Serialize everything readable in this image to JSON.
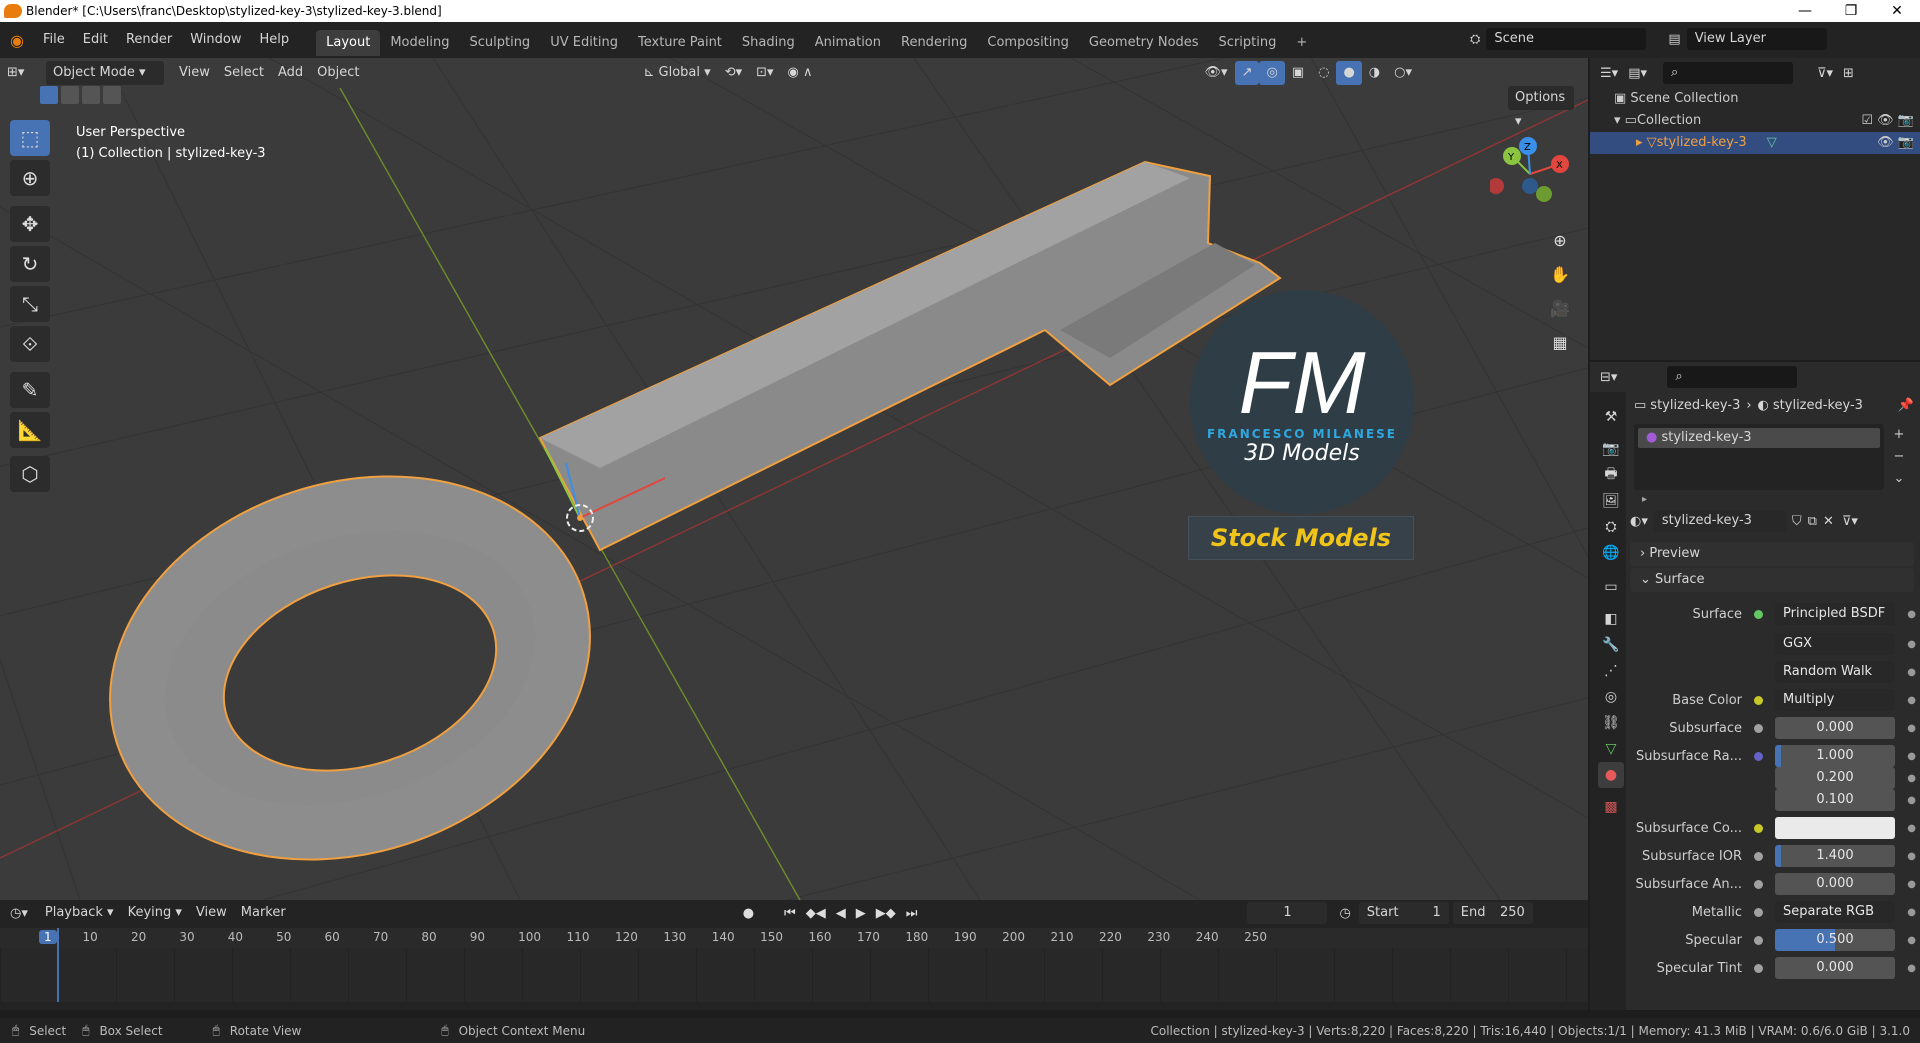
{
  "window": {
    "title": "Blender* [C:\\Users\\franc\\Desktop\\stylized-key-3\\stylized-key-3.blend]",
    "controls": [
      "—",
      "❐",
      "✕"
    ]
  },
  "menus": [
    "File",
    "Edit",
    "Render",
    "Window",
    "Help"
  ],
  "workspaces": [
    "Layout",
    "Modeling",
    "Sculpting",
    "UV Editing",
    "Texture Paint",
    "Shading",
    "Animation",
    "Rendering",
    "Compositing",
    "Geometry Nodes",
    "Scripting",
    "+"
  ],
  "scene": {
    "name": "Scene",
    "view_layer": "View Layer"
  },
  "viewport": {
    "mode": "Object Mode",
    "menus": [
      "View",
      "Select",
      "Add",
      "Object"
    ],
    "orientation": "Global",
    "options": "Options",
    "overlay_line1": "User Perspective",
    "overlay_line2": "(1) Collection | stylized-key-3",
    "gizmo": {
      "x": "X",
      "y": "Y",
      "z": "Z"
    }
  },
  "watermark": {
    "logo_text": "FM",
    "brand": "FRANCESCO MILANESE",
    "sub": "3D Models",
    "banner": "Stock Models"
  },
  "outliner": {
    "root": "Scene Collection",
    "collection": "Collection",
    "object": "stylized-key-3"
  },
  "properties": {
    "breadcrumb_obj": "stylized-key-3",
    "breadcrumb_mat": "stylized-key-3",
    "material_slot": "stylized-key-3",
    "material_name": "stylized-key-3",
    "preview": "Preview",
    "surface_section": "Surface",
    "rows": [
      {
        "label": "Surface",
        "value": "Principled BSDF",
        "kind": "dd",
        "socket": "#63c763"
      },
      {
        "label": "",
        "value": "GGX",
        "kind": "select"
      },
      {
        "label": "",
        "value": "Random Walk",
        "kind": "select"
      },
      {
        "label": "Base Color",
        "value": "Multiply",
        "kind": "dd",
        "socket": "#c7c729",
        "expand": true
      },
      {
        "label": "Subsurface",
        "value": "0.000",
        "kind": "num",
        "socket": "#a1a1a1"
      },
      {
        "label": "Subsurface Ra...",
        "value": "1.000",
        "kind": "num",
        "socket": "#6363c7",
        "fill": 0.05
      },
      {
        "label": "",
        "value": "0.200",
        "kind": "num"
      },
      {
        "label": "",
        "value": "0.100",
        "kind": "num"
      },
      {
        "label": "Subsurface Co...",
        "value": "",
        "kind": "color",
        "socket": "#c7c729"
      },
      {
        "label": "Subsurface IOR",
        "value": "1.400",
        "kind": "num",
        "socket": "#a1a1a1",
        "fill": 0.05
      },
      {
        "label": "Subsurface An...",
        "value": "0.000",
        "kind": "num",
        "socket": "#a1a1a1"
      },
      {
        "label": "Metallic",
        "value": "Separate RGB",
        "kind": "dd",
        "socket": "#a1a1a1",
        "expand": true
      },
      {
        "label": "Specular",
        "value": "0.500",
        "kind": "num",
        "socket": "#a1a1a1",
        "fill": 0.5
      },
      {
        "label": "Specular Tint",
        "value": "0.000",
        "kind": "num",
        "socket": "#a1a1a1"
      }
    ]
  },
  "timeline": {
    "menus": [
      "Playback",
      "Keying",
      "View",
      "Marker"
    ],
    "current_frame": "1",
    "start_label": "Start",
    "start": "1",
    "end_label": "End",
    "end": "250",
    "ticks": [
      "1",
      "10",
      "20",
      "30",
      "40",
      "50",
      "60",
      "70",
      "80",
      "90",
      "100",
      "110",
      "120",
      "130",
      "140",
      "150",
      "160",
      "170",
      "180",
      "190",
      "200",
      "210",
      "220",
      "230",
      "240",
      "250"
    ]
  },
  "status": {
    "select": "Select",
    "box_select": "Box Select",
    "rotate": "Rotate View",
    "context": "Object Context Menu",
    "stats": "Collection | stylized-key-3 | Verts:8,220 | Faces:8,220 | Tris:16,440 | Objects:1/1 | Memory: 41.3 MiB | VRAM: 0.6/6.0 GiB | 3.1.0"
  },
  "colors": {
    "accent": "#4772b3",
    "selection": "#f0a040",
    "x_axis": "#e2473f",
    "y_axis": "#8bc53f",
    "z_axis": "#3a8fe8"
  }
}
